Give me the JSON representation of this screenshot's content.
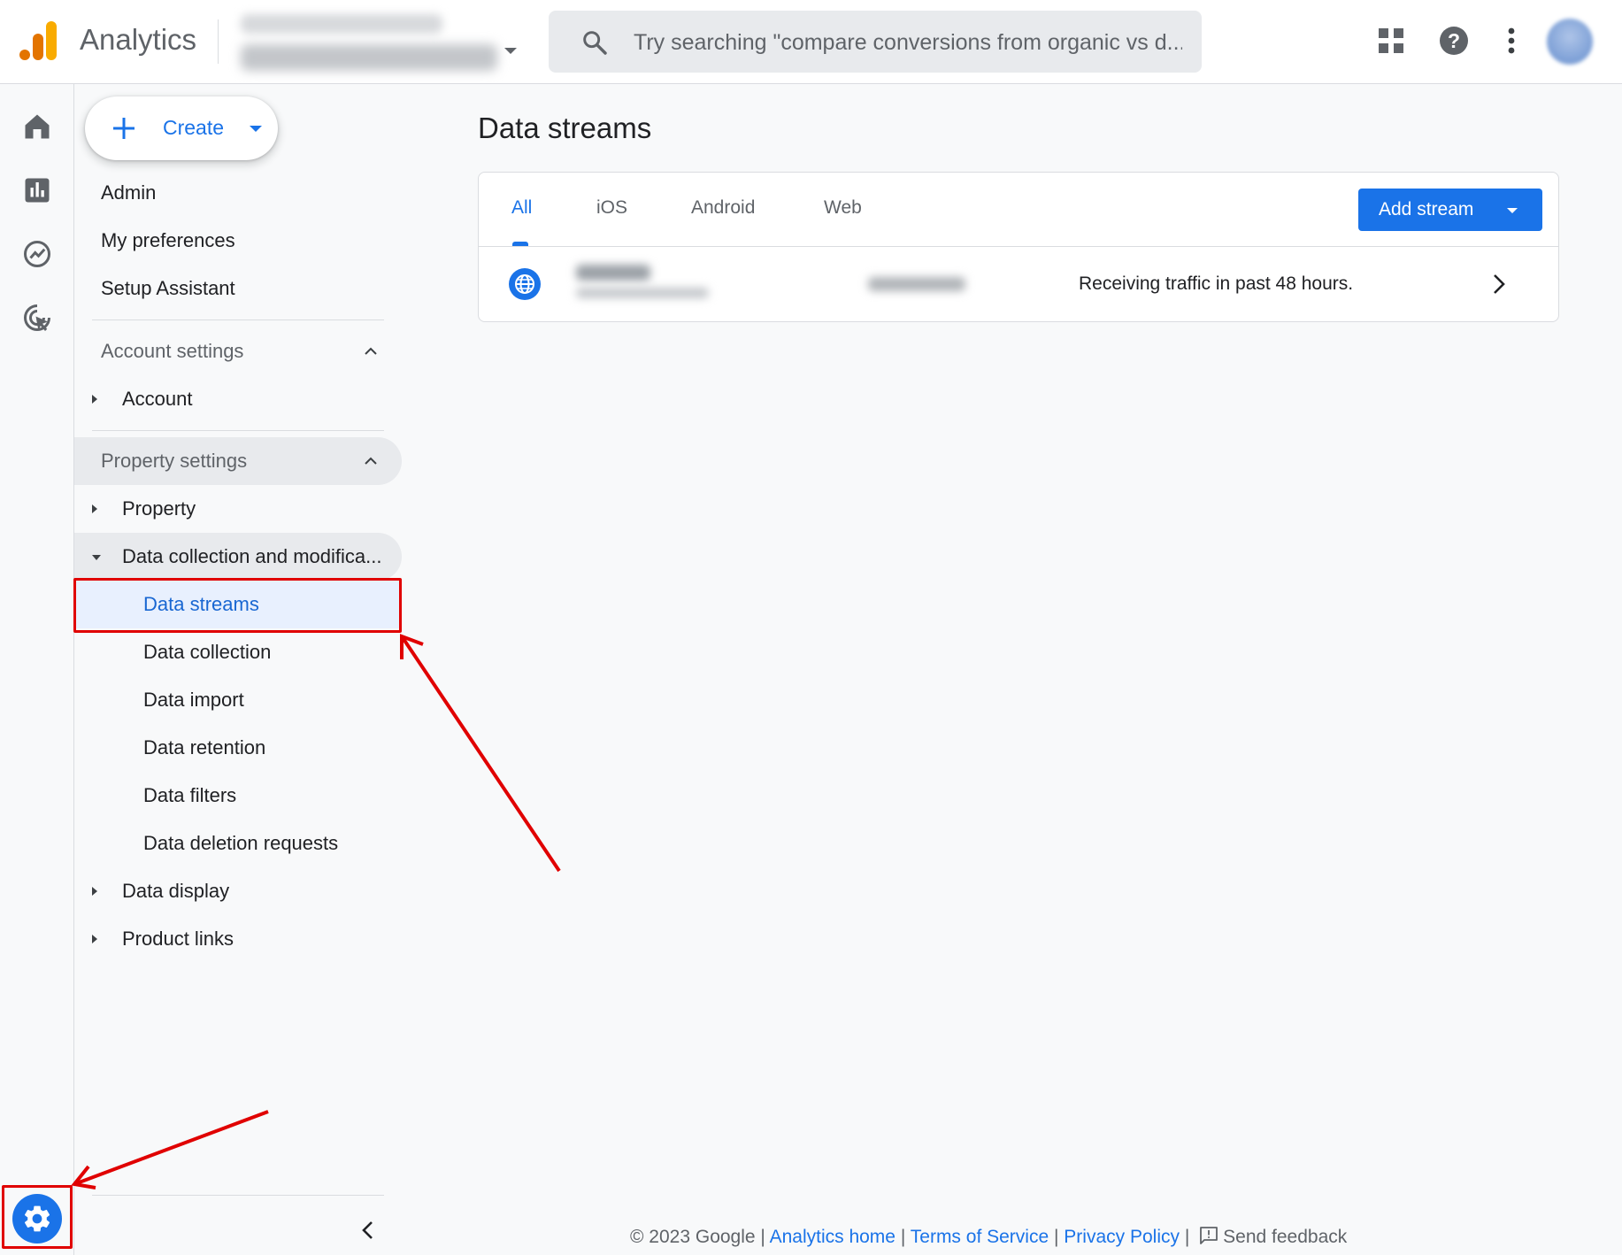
{
  "header": {
    "app_name": "Analytics",
    "search_placeholder": "Try searching \"compare conversions from organic vs d..."
  },
  "nav": {
    "create_label": "Create",
    "top_items": [
      "Admin",
      "My preferences",
      "Setup Assistant"
    ],
    "account_settings": {
      "label": "Account settings",
      "items": [
        "Account"
      ]
    },
    "property_settings": {
      "label": "Property settings",
      "property": "Property",
      "data_collection_group": "Data collection and modifica...",
      "data_collection_items": [
        "Data streams",
        "Data collection",
        "Data import",
        "Data retention",
        "Data filters",
        "Data deletion requests"
      ],
      "data_display": "Data display",
      "product_links": "Product links"
    },
    "active_item": "Data streams"
  },
  "main": {
    "title": "Data streams",
    "tabs": [
      "All",
      "iOS",
      "Android",
      "Web"
    ],
    "active_tab": "All",
    "add_stream_label": "Add stream",
    "streams": [
      {
        "type_icon": "globe-icon",
        "status": "Receiving traffic in past 48 hours."
      }
    ]
  },
  "footer": {
    "copyright": "© 2023 Google",
    "sep": "|",
    "links": [
      "Analytics home",
      "Terms of Service",
      "Privacy Policy"
    ],
    "feedback_label": "Send feedback"
  },
  "colors": {
    "accent": "#1a73e8",
    "active_bg": "#e8f0fe",
    "annotation": "#e00000",
    "logo_orange": "#f9ab00",
    "logo_dark_orange": "#e37400"
  }
}
